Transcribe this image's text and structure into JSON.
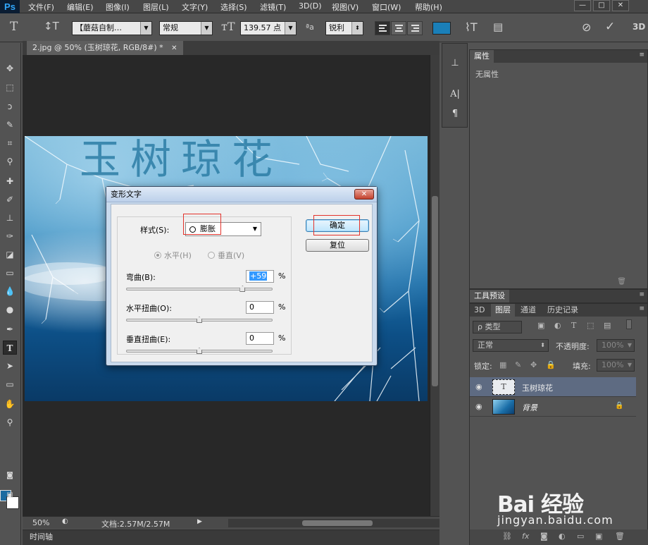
{
  "menubar": {
    "logo": "Ps",
    "items": [
      "文件(F)",
      "编辑(E)",
      "图像(I)",
      "图层(L)",
      "文字(Y)",
      "选择(S)",
      "滤镜(T)",
      "3D(D)",
      "视图(V)",
      "窗口(W)",
      "帮助(H)"
    ]
  },
  "options": {
    "font_family": "【蘑菇自制…",
    "font_style": "常规",
    "font_size": "139.57 点",
    "aa_label": "ªa",
    "anti_alias": "锐利",
    "mode_3d": "3D",
    "text_color": "#1a7fb8"
  },
  "document": {
    "tab_title": "2.jpg @ 50% (玉树琼花, RGB/8#) *",
    "photo_text": "玉树琼花",
    "zoom": "50%",
    "doc_info": "文档:2.57M/2.57M",
    "timeline": "时间轴"
  },
  "dialog": {
    "title": "变形文字",
    "style_label": "样式(S):",
    "style_value": "膨胀",
    "horizontal": "水平(H)",
    "vertical": "垂直(V)",
    "bend_label": "弯曲(B):",
    "bend_value": "+59",
    "h_distort_label": "水平扭曲(O):",
    "h_distort_value": "0",
    "v_distort_label": "垂直扭曲(E):",
    "v_distort_value": "0",
    "percent": "%",
    "ok": "确定",
    "reset": "复位",
    "bend_level": 0.795,
    "h_distort_level": 0.5,
    "v_distort_level": 0.5
  },
  "properties": {
    "tab": "属性",
    "empty": "无属性"
  },
  "tool_presets": {
    "tab": "工具预设"
  },
  "layers_panel": {
    "tabs": [
      "3D",
      "图层",
      "通道",
      "历史记录"
    ],
    "filter": "ρ 类型",
    "blend_mode": "正常",
    "opacity_label": "不透明度:",
    "opacity_value": "100%",
    "lock_label": "锁定:",
    "fill_label": "填充:",
    "fill_value": "100%",
    "layers": [
      {
        "name": "玉树琼花",
        "type": "text"
      },
      {
        "name": "背景",
        "type": "image"
      }
    ]
  },
  "watermark": {
    "brand": "Bai 经验",
    "url": "jingyan.baidu.com"
  }
}
